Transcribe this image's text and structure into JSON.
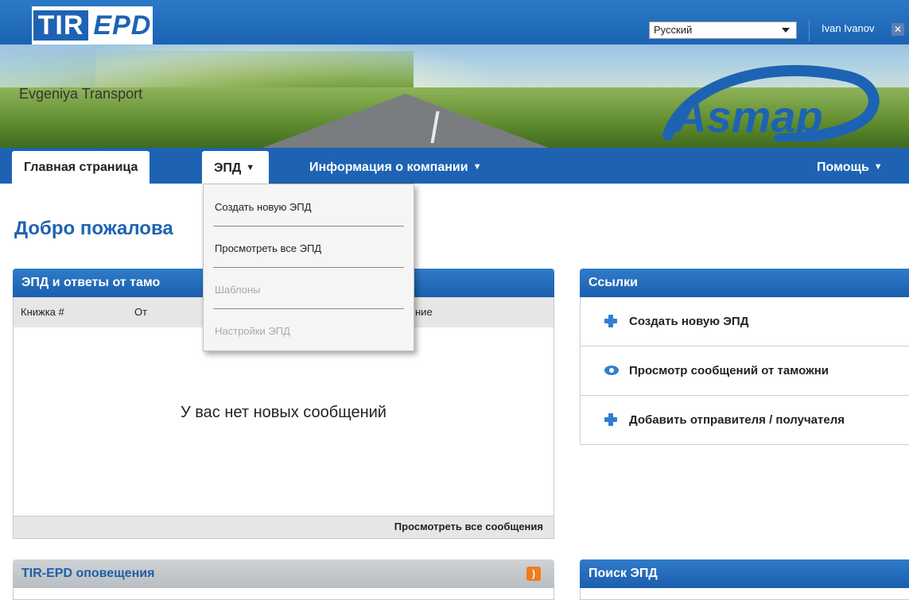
{
  "header": {
    "logo_tir": "TIR",
    "logo_epd": "EPD",
    "company_name": "Evgeniya Transport",
    "language": "Русский",
    "user_name": "Ivan Ivanov",
    "partner_logo": "Asmap"
  },
  "nav": {
    "home": "Главная страница",
    "epd": "ЭПД",
    "company_info": "Информация о компании",
    "help": "Помощь",
    "caret": "▼"
  },
  "dropdown": {
    "items": [
      {
        "label": "Создать новую ЭПД",
        "enabled": true
      },
      {
        "label": "Просмотреть все ЭПД",
        "enabled": true
      },
      {
        "label": "Шаблоны",
        "enabled": false
      },
      {
        "label": "Настройки ЭПД",
        "enabled": false
      }
    ]
  },
  "main": {
    "welcome_title": "Добро пожалова",
    "messages_panel": {
      "title": "ЭПД и ответы от тамо",
      "columns": [
        "Книжка #",
        "От",
        "ние"
      ],
      "empty_message": "У вас нет новых сообщений",
      "view_all": "Просмотреть все сообщения"
    },
    "alerts_panel": {
      "title": "TIR-EPD оповещения",
      "icon": "rss-icon"
    }
  },
  "links_panel": {
    "title": "Ссылки",
    "items": [
      {
        "label": "Создать новую ЭПД",
        "icon": "plus-icon"
      },
      {
        "label": "Просмотр сообщений от таможни",
        "icon": "eye-icon"
      },
      {
        "label": "Добавить отправителя / получателя",
        "icon": "plus-icon"
      }
    ]
  },
  "search_panel": {
    "title": "Поиск ЭПД"
  },
  "colors": {
    "brand_blue": "#1e63b3",
    "panel_grey": "#e6e6e6",
    "rss_orange": "#f07c1d"
  }
}
